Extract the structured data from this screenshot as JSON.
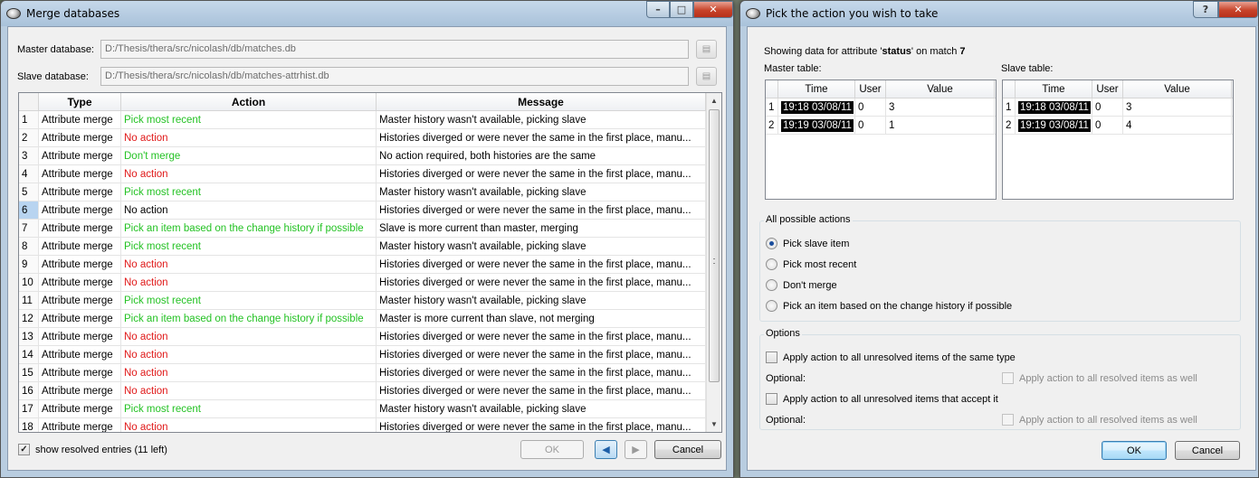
{
  "merge_window": {
    "title": "Merge databases",
    "master_label": "Master database:",
    "master_path": "D:/Thesis/thera/src/nicolash/db/matches.db",
    "slave_label": "Slave database:",
    "slave_path": "D:/Thesis/thera/src/nicolash/db/matches-attrhist.db",
    "columns": [
      "",
      "Type",
      "Action",
      "Message"
    ],
    "rows": [
      {
        "idx": "1",
        "type": "Attribute merge",
        "action": "Pick most recent",
        "action_color": "green",
        "message": "Master history wasn't available, picking slave"
      },
      {
        "idx": "2",
        "type": "Attribute merge",
        "action": "No action",
        "action_color": "red",
        "message": "Histories diverged or were never the same in the first place, manu..."
      },
      {
        "idx": "3",
        "type": "Attribute merge",
        "action": "Don't merge",
        "action_color": "green",
        "message": "No action required, both histories are the same"
      },
      {
        "idx": "4",
        "type": "Attribute merge",
        "action": "No action",
        "action_color": "red",
        "message": "Histories diverged or were never the same in the first place, manu..."
      },
      {
        "idx": "5",
        "type": "Attribute merge",
        "action": "Pick most recent",
        "action_color": "green",
        "message": "Master history wasn't available, picking slave"
      },
      {
        "idx": "6",
        "type": "Attribute merge",
        "action": "No action",
        "action_color": "black",
        "message": "Histories diverged or were never the same in the first place, manu...",
        "selected": true
      },
      {
        "idx": "7",
        "type": "Attribute merge",
        "action": "Pick an item based on the change history if possible",
        "action_color": "green",
        "message": "Slave is more current than master, merging"
      },
      {
        "idx": "8",
        "type": "Attribute merge",
        "action": "Pick most recent",
        "action_color": "green",
        "message": "Master history wasn't available, picking slave"
      },
      {
        "idx": "9",
        "type": "Attribute merge",
        "action": "No action",
        "action_color": "red",
        "message": "Histories diverged or were never the same in the first place, manu..."
      },
      {
        "idx": "10",
        "type": "Attribute merge",
        "action": "No action",
        "action_color": "red",
        "message": "Histories diverged or were never the same in the first place, manu..."
      },
      {
        "idx": "11",
        "type": "Attribute merge",
        "action": "Pick most recent",
        "action_color": "green",
        "message": "Master history wasn't available, picking slave"
      },
      {
        "idx": "12",
        "type": "Attribute merge",
        "action": "Pick an item based on the change history if possible",
        "action_color": "green",
        "message": "Master is more current than slave, not merging"
      },
      {
        "idx": "13",
        "type": "Attribute merge",
        "action": "No action",
        "action_color": "red",
        "message": "Histories diverged or were never the same in the first place, manu..."
      },
      {
        "idx": "14",
        "type": "Attribute merge",
        "action": "No action",
        "action_color": "red",
        "message": "Histories diverged or were never the same in the first place, manu..."
      },
      {
        "idx": "15",
        "type": "Attribute merge",
        "action": "No action",
        "action_color": "red",
        "message": "Histories diverged or were never the same in the first place, manu..."
      },
      {
        "idx": "16",
        "type": "Attribute merge",
        "action": "No action",
        "action_color": "red",
        "message": "Histories diverged or were never the same in the first place, manu..."
      },
      {
        "idx": "17",
        "type": "Attribute merge",
        "action": "Pick most recent",
        "action_color": "green",
        "message": "Master history wasn't available, picking slave"
      },
      {
        "idx": "18",
        "type": "Attribute merge",
        "action": "No action",
        "action_color": "red",
        "message": "Histories diverged or were never the same in the first place, manu..."
      }
    ],
    "show_resolved_label": "show resolved entries (11 left)",
    "show_resolved_checked": true,
    "ok_label": "OK",
    "cancel_label": "Cancel"
  },
  "action_window": {
    "title": "Pick the action you wish to take",
    "info_prefix": "Showing data for attribute '",
    "attribute": "status",
    "info_middle": "' on match ",
    "match": "7",
    "master_table_label": "Master table:",
    "slave_table_label": "Slave table:",
    "table_columns": [
      "",
      "Time",
      "User",
      "Value"
    ],
    "master_rows": [
      {
        "idx": "1",
        "time": "19:18 03/08/11",
        "user": "0",
        "value": "3"
      },
      {
        "idx": "2",
        "time": "19:19 03/08/11",
        "user": "0",
        "value": "1"
      }
    ],
    "slave_rows": [
      {
        "idx": "1",
        "time": "19:18 03/08/11",
        "user": "0",
        "value": "3"
      },
      {
        "idx": "2",
        "time": "19:19 03/08/11",
        "user": "0",
        "value": "4"
      }
    ],
    "actions_group": "All possible actions",
    "actions": [
      "Pick slave item",
      "Pick most recent",
      "Don't merge",
      "Pick an item based on the change history if possible"
    ],
    "selected_action": 0,
    "options_group": "Options",
    "apply_same_type": "Apply action to all unresolved items of the same type",
    "optional_label": "Optional:",
    "apply_resolved": "Apply action to all resolved items as well",
    "apply_accept": "Apply action to all unresolved items that accept it",
    "ok_label": "OK",
    "cancel_label": "Cancel"
  },
  "colors": {
    "green": "#24c224",
    "red": "#e01818",
    "black": "#000000"
  }
}
